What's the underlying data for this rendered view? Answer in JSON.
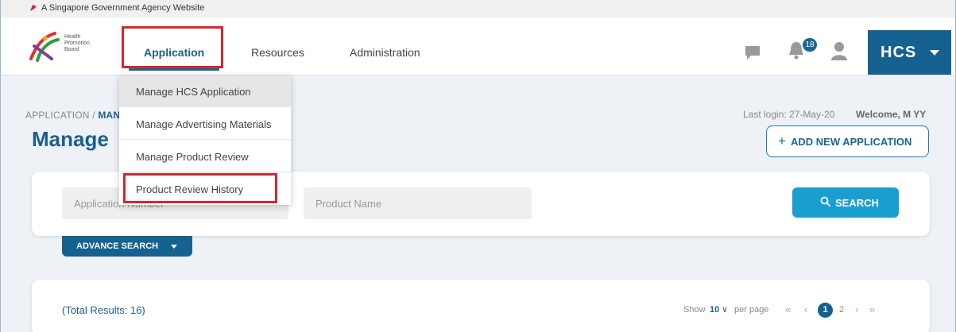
{
  "gov_banner": {
    "text": "A Singapore Government Agency Website"
  },
  "logo": {
    "text": "Health Promotion Board"
  },
  "nav": {
    "items": [
      {
        "label": "Application"
      },
      {
        "label": "Resources"
      },
      {
        "label": "Administration"
      }
    ],
    "notification_count": "18",
    "account_label": "HCS"
  },
  "dropdown": {
    "items": [
      {
        "label": "Manage HCS Application"
      },
      {
        "label": "Manage Advertising Materials"
      },
      {
        "label": "Manage Product Review"
      },
      {
        "label": "Product Review History"
      }
    ]
  },
  "breadcrumb": {
    "root": "APPLICATION",
    "separator": "/",
    "current": "MAN"
  },
  "header_info": {
    "last_login": "Last login: 27-May-20",
    "welcome": "Welcome, M YY"
  },
  "page_title": "Manage",
  "add_button": {
    "icon": "+",
    "label": "ADD NEW APPLICATION"
  },
  "search": {
    "application_number_placeholder": "Application Number",
    "product_name_placeholder": "Product Name",
    "button_label": "SEARCH",
    "advance_search_label": "ADVANCE SEARCH"
  },
  "results": {
    "total": "(Total Results: 16)",
    "show_label": "Show",
    "per_page_value": "10",
    "per_page_label": "per page",
    "current_page": "1",
    "next_page": "2",
    "first_symbol": "«",
    "prev_symbol": "‹",
    "next_symbol": "›",
    "last_symbol": "»"
  },
  "colors": {
    "primary": "#15618f",
    "accent": "#1a9ed0",
    "highlight": "#d8252d"
  }
}
